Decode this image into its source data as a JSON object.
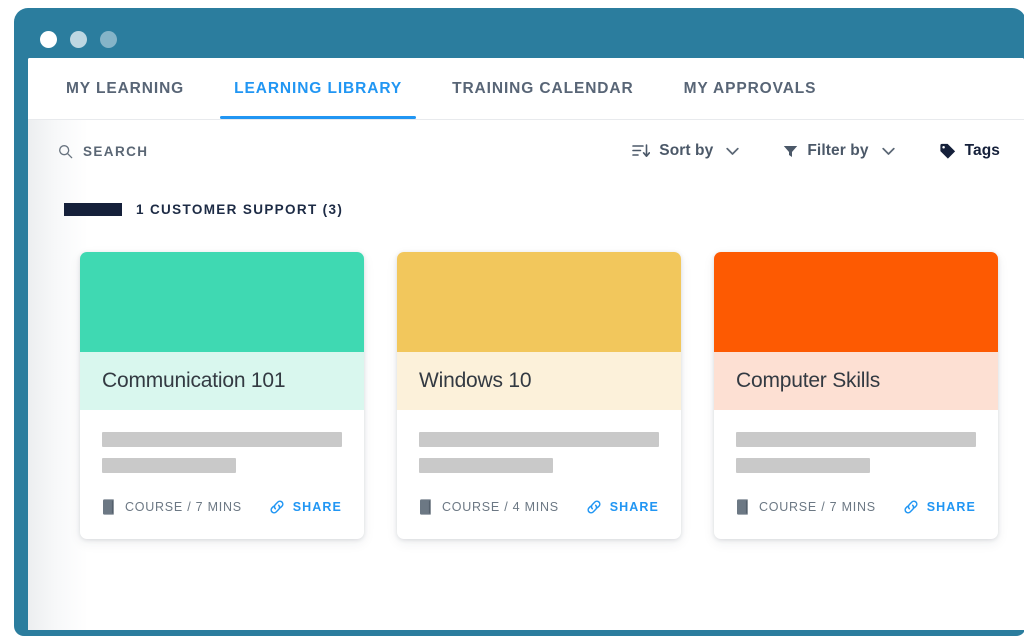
{
  "window": {
    "chrome_color": "#2b7d9e",
    "dots": [
      {
        "name": "close-dot",
        "color": "#ffffff"
      },
      {
        "name": "minimize-dot",
        "color": "#bdd7e2"
      },
      {
        "name": "maximize-dot",
        "color": "#85b4c8"
      }
    ]
  },
  "tabs": [
    {
      "label": "MY LEARNING",
      "active": false
    },
    {
      "label": "LEARNING LIBRARY",
      "active": true
    },
    {
      "label": "TRAINING CALENDAR",
      "active": false
    },
    {
      "label": "MY APPROVALS",
      "active": false
    }
  ],
  "toolbar": {
    "search_label": "SEARCH",
    "search_placeholder": "SEARCH",
    "sort_label": "Sort by",
    "filter_label": "Filter by",
    "tags_label": "Tags",
    "accent_color": "#2196f3"
  },
  "category": {
    "label": "1 CUSTOMER SUPPORT (3)",
    "swatch_color": "#15203a"
  },
  "cards": [
    {
      "title": "Communication 101",
      "banner_color": "#3fd9b2",
      "band_color": "#d9f7ee",
      "meta": "COURSE / 7 MINS",
      "share_label": "SHARE"
    },
    {
      "title": "Windows 10",
      "banner_color": "#f2c75c",
      "band_color": "#fcf1da",
      "meta": "COURSE / 4 MINS",
      "share_label": "SHARE"
    },
    {
      "title": "Computer Skills",
      "banner_color": "#fd5a02",
      "band_color": "#fde0d3",
      "meta": "COURSE / 7 MINS",
      "share_label": "SHARE"
    }
  ]
}
